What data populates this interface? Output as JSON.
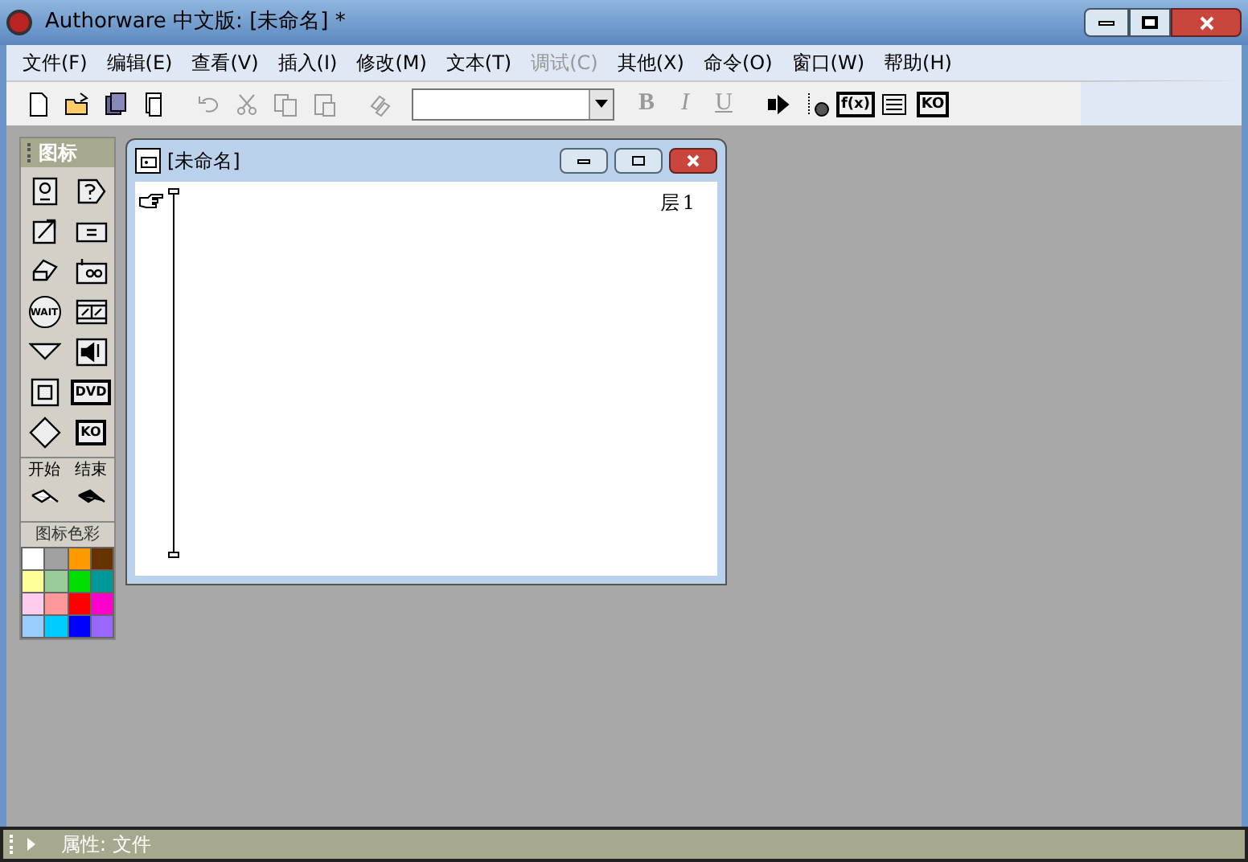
{
  "window": {
    "title": "Authorware 中文版: [未命名] *"
  },
  "menu": [
    {
      "label": "文件(F)",
      "disabled": false
    },
    {
      "label": "编辑(E)",
      "disabled": false
    },
    {
      "label": "查看(V)",
      "disabled": false
    },
    {
      "label": "插入(I)",
      "disabled": false
    },
    {
      "label": "修改(M)",
      "disabled": false
    },
    {
      "label": "文本(T)",
      "disabled": false
    },
    {
      "label": "调试(C)",
      "disabled": true
    },
    {
      "label": "其他(X)",
      "disabled": false
    },
    {
      "label": "命令(O)",
      "disabled": false
    },
    {
      "label": "窗口(W)",
      "disabled": false
    },
    {
      "label": "帮助(H)",
      "disabled": false
    }
  ],
  "toolbar": [
    {
      "kind": "new",
      "disabled": false
    },
    {
      "kind": "open",
      "disabled": false
    },
    {
      "kind": "save-all",
      "disabled": false
    },
    {
      "kind": "import",
      "disabled": false
    },
    {
      "kind": "gap"
    },
    {
      "kind": "undo",
      "disabled": true
    },
    {
      "kind": "cut",
      "disabled": true
    },
    {
      "kind": "copy",
      "disabled": true
    },
    {
      "kind": "paste",
      "disabled": true
    },
    {
      "kind": "gap"
    },
    {
      "kind": "link",
      "disabled": true
    },
    {
      "kind": "select"
    },
    {
      "kind": "bold",
      "label": "B",
      "disabled": true
    },
    {
      "kind": "italic",
      "label": "I",
      "disabled": true
    },
    {
      "kind": "underline",
      "label": "U",
      "disabled": true
    },
    {
      "kind": "gap"
    },
    {
      "kind": "restart",
      "disabled": false
    },
    {
      "kind": "flag",
      "disabled": false
    },
    {
      "kind": "boxed",
      "label": "f(x)",
      "disabled": false
    },
    {
      "kind": "list",
      "disabled": false
    },
    {
      "kind": "boxed",
      "label": "KO",
      "disabled": false
    }
  ],
  "icons_panel": {
    "title": "图标",
    "icons": [
      {
        "kind": "display"
      },
      {
        "kind": "question"
      },
      {
        "kind": "motion"
      },
      {
        "kind": "equals"
      },
      {
        "kind": "eraser"
      },
      {
        "kind": "navigate"
      },
      {
        "kind": "octagon",
        "label": "WAIT"
      },
      {
        "kind": "film"
      },
      {
        "kind": "triangle"
      },
      {
        "kind": "sound"
      },
      {
        "kind": "frame"
      },
      {
        "kind": "boxed",
        "label": "DVD"
      },
      {
        "kind": "diamond"
      },
      {
        "kind": "boxed",
        "label": "KO"
      }
    ],
    "flags_labels": [
      "开始",
      "结束"
    ],
    "flags": [
      {
        "kind": "flag-outline"
      },
      {
        "kind": "flag-filled"
      }
    ],
    "colors_title": "图标色彩",
    "colors": [
      {
        "color": "#ffffff"
      },
      {
        "color": "#a0a0a0"
      },
      {
        "color": "#ff9900"
      },
      {
        "color": "#663300"
      },
      {
        "color": "#ffff99"
      },
      {
        "color": "#99cc99"
      },
      {
        "color": "#00dd00"
      },
      {
        "color": "#009999"
      },
      {
        "color": "#ffccee"
      },
      {
        "color": "#ff9999"
      },
      {
        "color": "#ff0000"
      },
      {
        "color": "#ff00cc"
      },
      {
        "color": "#99ccff"
      },
      {
        "color": "#00ccff"
      },
      {
        "color": "#0000ff"
      },
      {
        "color": "#9966ff"
      }
    ]
  },
  "flow_window": {
    "title": "[未命名]",
    "level_label": "层",
    "level": "1"
  },
  "status_bar": {
    "label": "属性: 文件"
  }
}
